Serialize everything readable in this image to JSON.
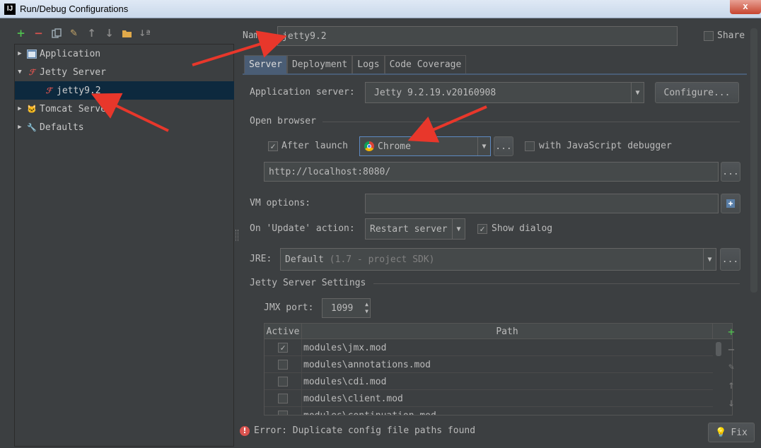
{
  "window": {
    "title": "Run/Debug Configurations",
    "app_icon": "IJ",
    "close_glyph": "x"
  },
  "tree": {
    "items": [
      {
        "label": "Application",
        "icon": "application-icon"
      },
      {
        "label": "Jetty Server",
        "icon": "jetty-icon"
      },
      {
        "label": "jetty9.2",
        "icon": "jetty-error-icon"
      },
      {
        "label": "Tomcat Server",
        "icon": "tomcat-icon"
      },
      {
        "label": "Defaults",
        "icon": "wrench-icon"
      }
    ]
  },
  "form": {
    "name_label": "Name:",
    "name_value": "jetty9.2",
    "share_label": "Share",
    "tabs": [
      "Server",
      "Deployment",
      "Logs",
      "Code Coverage"
    ],
    "app_server_label": "Application server:",
    "app_server_value": "Jetty 9.2.19.v20160908",
    "configure_label": "Configure...",
    "open_browser_label": "Open browser",
    "after_launch_label": "After launch",
    "browser_value": "Chrome",
    "ellipsis": "...",
    "js_debugger_label": "with JavaScript debugger",
    "url_value": "http://localhost:8080/",
    "vm_options_label": "VM options:",
    "on_update_label": "On 'Update' action:",
    "on_update_value": "Restart server",
    "show_dialog_label": "Show dialog",
    "jre_label": "JRE:",
    "jre_value": "Default",
    "jre_hint": "(1.7 - project SDK)",
    "jetty_settings_label": "Jetty Server Settings",
    "jmx_port_label": "JMX port:",
    "jmx_port_value": "1099",
    "table_headers": [
      "Active",
      "Path"
    ],
    "table_rows": [
      {
        "active": true,
        "path": "modules\\jmx.mod"
      },
      {
        "active": false,
        "path": "modules\\annotations.mod"
      },
      {
        "active": false,
        "path": "modules\\cdi.mod"
      },
      {
        "active": false,
        "path": "modules\\client.mod"
      },
      {
        "active": false,
        "path": "modules\\continuation.mod"
      }
    ]
  },
  "status": {
    "error_text": "Error: Duplicate config file paths found",
    "fix_label": "Fix"
  },
  "colors": {
    "background": "#3c3f41",
    "selection": "#0d293e",
    "accent_tab": "#4a5d75",
    "annotation_arrow": "#e8372b"
  }
}
